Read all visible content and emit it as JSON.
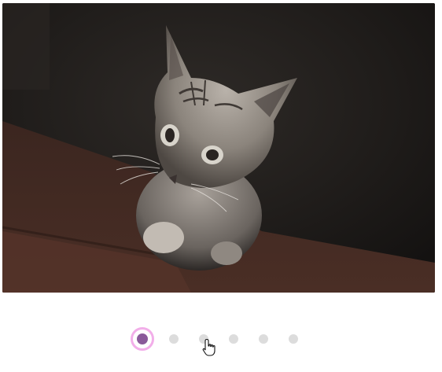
{
  "carousel": {
    "slide": {
      "subject": "kitten-photo",
      "alt_text": ""
    },
    "pagination": {
      "total": 6,
      "active_index": 0,
      "active_color": "#8a5a9a",
      "active_ring_color": "#f2aee9",
      "inactive_color": "#dcdcdc"
    }
  },
  "cursor": {
    "type": "pointer-hand"
  }
}
